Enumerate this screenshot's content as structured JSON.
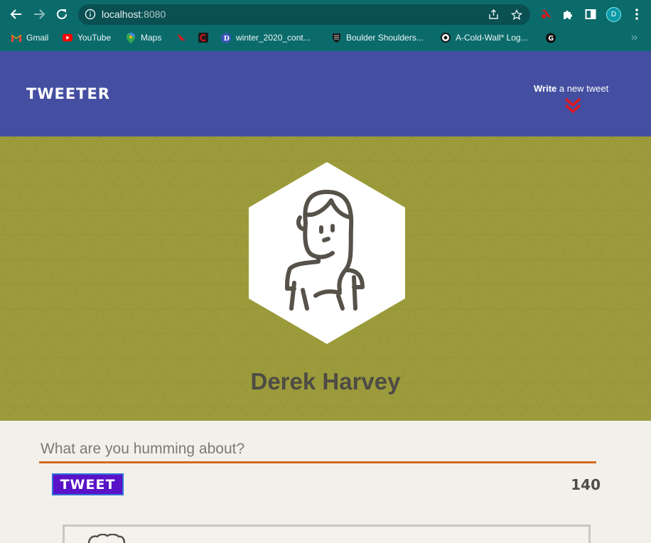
{
  "browser": {
    "url_host": "localhost",
    "url_port": ":8080",
    "profile_initial": "D",
    "bookmarks": [
      {
        "label": "Gmail",
        "icon": "gmail-icon"
      },
      {
        "label": "YouTube",
        "icon": "youtube-icon"
      },
      {
        "label": "Maps",
        "icon": "maps-icon"
      },
      {
        "label": "",
        "icon": "cardinal-icon"
      },
      {
        "label": "",
        "icon": "c-icon"
      },
      {
        "label": "winter_2020_cont...",
        "icon": "d-icon"
      },
      {
        "label": "Boulder Shoulders...",
        "icon": "shield-icon"
      },
      {
        "label": "A-Cold-Wall* Log...",
        "icon": "acw-icon"
      },
      {
        "label": "",
        "icon": "g-icon"
      }
    ]
  },
  "nav": {
    "logo": "TWEETER",
    "compose_bold": "Write",
    "compose_rest": " a new tweet"
  },
  "profile": {
    "name": "Derek Harvey"
  },
  "composer": {
    "placeholder": "What are you humming about?",
    "button_label": "TWEET",
    "counter": "140"
  },
  "colors": {
    "nav_bg": "#444fa2",
    "hero_bg": "#9c9b3b",
    "accent_underline": "#d46a1d",
    "button_bg": "#5a12c8",
    "chevron": "#e0161e"
  }
}
